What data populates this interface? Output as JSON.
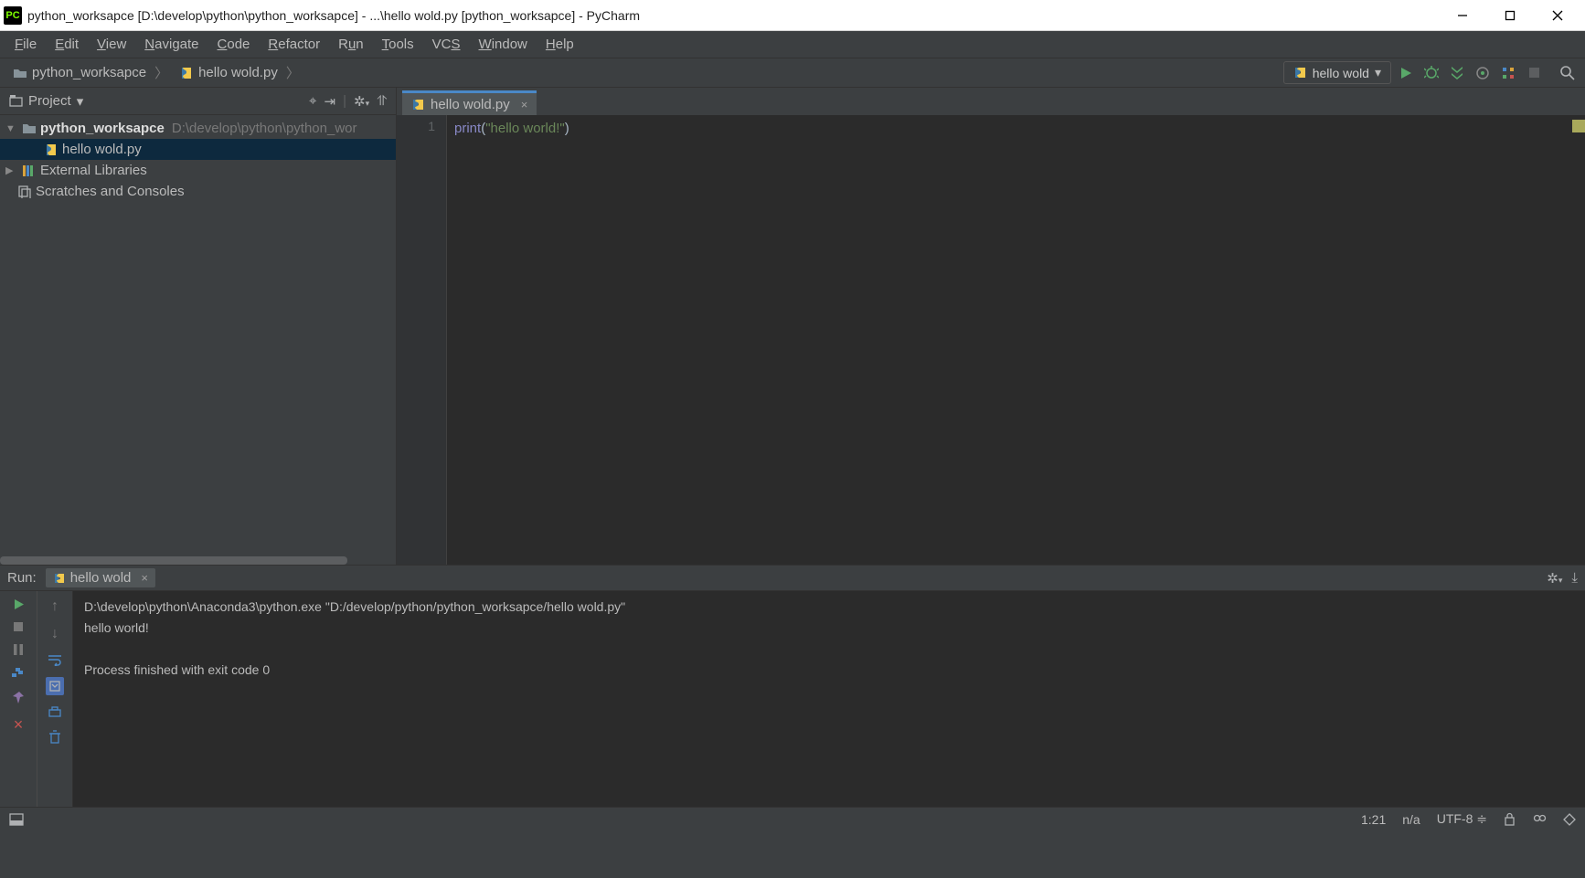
{
  "window": {
    "title": "python_worksapce [D:\\develop\\python\\python_worksapce] - ...\\hello wold.py [python_worksapce] - PyCharm"
  },
  "menus": [
    "File",
    "Edit",
    "View",
    "Navigate",
    "Code",
    "Refactor",
    "Run",
    "Tools",
    "VCS",
    "Window",
    "Help"
  ],
  "breadcrumbs": [
    {
      "icon": "folder",
      "label": "python_worksapce"
    },
    {
      "icon": "py",
      "label": "hello wold.py"
    }
  ],
  "run_config": {
    "label": "hello wold"
  },
  "project_panel": {
    "title": "Project",
    "root": {
      "name": "python_worksapce",
      "path": "D:\\develop\\python\\python_wor"
    },
    "file": {
      "name": "hello wold.py"
    },
    "external": "External Libraries",
    "scratches": "Scratches and Consoles"
  },
  "editor": {
    "tab": "hello wold.py",
    "lineno": "1",
    "code": {
      "fn": "print",
      "open": "(",
      "str": "\"hello world!\"",
      "close": ")"
    }
  },
  "run": {
    "title": "Run:",
    "conf": "hello wold",
    "console_cmd": "D:\\develop\\python\\Anaconda3\\python.exe \"D:/develop/python/python_worksapce/hello wold.py\"",
    "console_out": "hello world!",
    "console_exit": "Process finished with exit code 0"
  },
  "status": {
    "pos": "1:21",
    "sep": "n/a",
    "enc": "UTF-8"
  }
}
